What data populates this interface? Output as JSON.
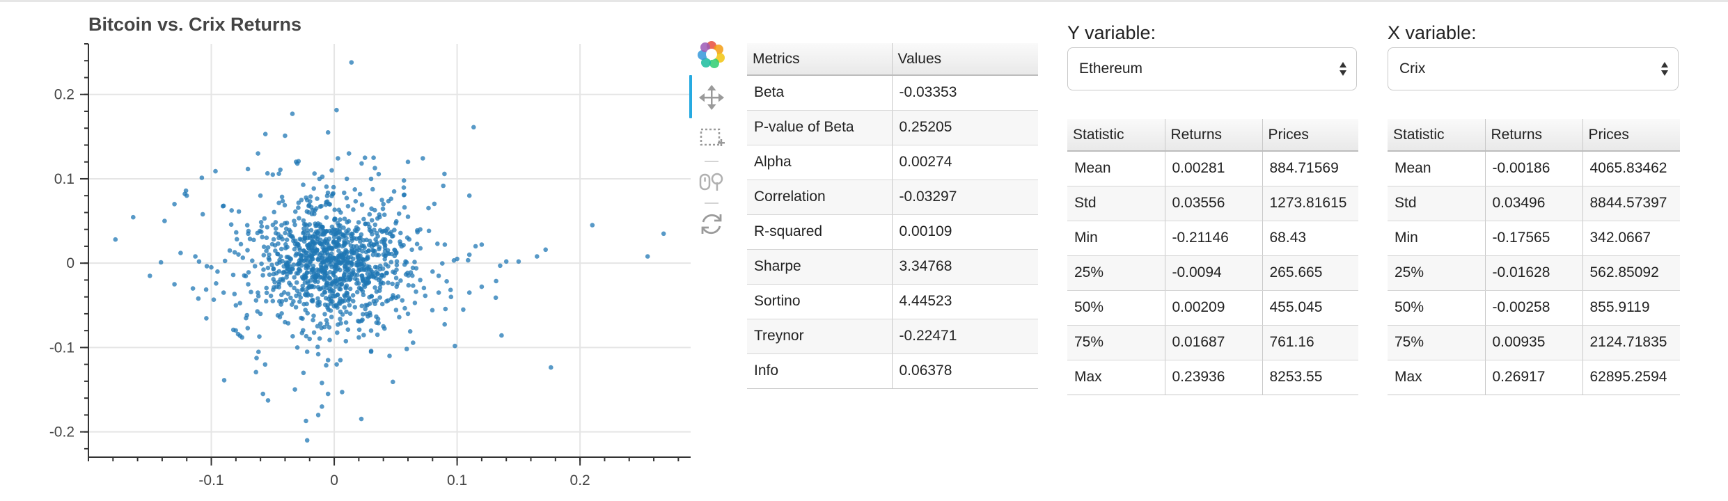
{
  "chart_data": {
    "type": "scatter",
    "title": "Bitcoin vs. Crix Returns",
    "xlabel": "",
    "ylabel": "",
    "xlim": [
      -0.2,
      0.29
    ],
    "ylim": [
      -0.23,
      0.26
    ],
    "xticks": [
      -0.1,
      0,
      0.1,
      0.2
    ],
    "xtick_labels": [
      "-0.1",
      "0",
      "0.1",
      "0.2"
    ],
    "yticks": [
      -0.2,
      -0.1,
      0,
      0.1,
      0.2
    ],
    "ytick_labels": [
      "-0.2",
      "-0.1",
      "0",
      "0.1",
      "0.2"
    ],
    "grid": true,
    "point_color": "#1f77b4",
    "approx_num_points": 1200,
    "central_spread": {
      "x_std": 0.028,
      "y_std": 0.032
    },
    "points": [
      [
        0.014,
        0.238
      ],
      [
        -0.034,
        0.177
      ],
      [
        -0.056,
        0.153
      ],
      [
        -0.04,
        0.151
      ],
      [
        -0.005,
        0.155
      ],
      [
        0.012,
        0.13
      ],
      [
        0.032,
        0.125
      ],
      [
        -0.062,
        0.13
      ],
      [
        0.025,
        0.125
      ],
      [
        -0.03,
        0.118
      ],
      [
        -0.05,
        0.105
      ],
      [
        -0.045,
        0.106
      ],
      [
        -0.002,
        0.11
      ],
      [
        0.03,
        0.1
      ],
      [
        -0.012,
        0.1
      ],
      [
        0.11,
        0.08
      ],
      [
        -0.12,
        0.08
      ],
      [
        -0.13,
        0.07
      ],
      [
        -0.09,
        0.068
      ],
      [
        0.04,
        0.07
      ],
      [
        -0.178,
        0.028
      ],
      [
        -0.138,
        0.05
      ],
      [
        -0.125,
        0.012
      ],
      [
        -0.113,
        0.008
      ],
      [
        -0.11,
        0.002
      ],
      [
        -0.1,
        -0.005
      ],
      [
        -0.09,
        -0.035
      ],
      [
        -0.115,
        -0.03
      ],
      [
        -0.13,
        -0.025
      ],
      [
        -0.15,
        -0.015
      ],
      [
        -0.141,
        0.001
      ],
      [
        -0.08,
        -0.05
      ],
      [
        -0.075,
        -0.088
      ],
      [
        0.115,
        0.02
      ],
      [
        0.12,
        0.022
      ],
      [
        0.14,
        0.002
      ],
      [
        0.135,
        -0.003
      ],
      [
        0.15,
        0.002
      ],
      [
        0.165,
        0.008
      ],
      [
        0.172,
        0.016
      ],
      [
        0.21,
        0.045
      ],
      [
        0.255,
        0.008
      ],
      [
        0.268,
        0.035
      ],
      [
        0.11,
        -0.035
      ],
      [
        0.12,
        -0.028
      ],
      [
        0.105,
        -0.055
      ],
      [
        0.095,
        -0.04
      ],
      [
        0.085,
        -0.035
      ],
      [
        0.11,
        0.01
      ],
      [
        0.1,
        0.005
      ],
      [
        0.04,
        -0.075
      ],
      [
        0.03,
        -0.08
      ],
      [
        0.02,
        -0.088
      ],
      [
        0.045,
        -0.11
      ],
      [
        0.03,
        -0.105
      ],
      [
        -0.04,
        -0.07
      ],
      [
        -0.03,
        -0.1
      ],
      [
        -0.022,
        -0.105
      ],
      [
        -0.013,
        -0.108
      ],
      [
        -0.058,
        -0.155
      ],
      [
        -0.025,
        -0.13
      ],
      [
        -0.005,
        -0.115
      ],
      [
        0.002,
        -0.12
      ],
      [
        0.005,
        -0.115
      ],
      [
        -0.01,
        -0.142
      ],
      [
        -0.005,
        -0.155
      ],
      [
        -0.01,
        -0.17
      ],
      [
        -0.013,
        -0.18
      ],
      [
        -0.023,
        -0.187
      ],
      [
        -0.022,
        -0.21
      ],
      [
        0.06,
        0.12
      ],
      [
        -0.06,
        0.08
      ],
      [
        -0.07,
        0.035
      ],
      [
        0.06,
        0.055
      ],
      [
        0.07,
        0.04
      ],
      [
        0.07,
        -0.02
      ],
      [
        0.08,
        -0.01
      ],
      [
        0.06,
        -0.06
      ],
      [
        -0.06,
        -0.06
      ],
      [
        -0.05,
        -0.045
      ],
      [
        0.09,
        0.022
      ],
      [
        0.085,
        -0.015
      ],
      [
        -0.085,
        0.015
      ],
      [
        -0.095,
        -0.01
      ],
      [
        -0.07,
        -0.025
      ]
    ]
  },
  "metrics_table": {
    "headers": [
      "Metrics",
      "Values"
    ],
    "rows": [
      [
        "Beta",
        "-0.03353"
      ],
      [
        "P-value of Beta",
        "0.25205"
      ],
      [
        "Alpha",
        "0.00274"
      ],
      [
        "Correlation",
        "-0.03297"
      ],
      [
        "R-squared",
        "0.00109"
      ],
      [
        "Sharpe",
        "3.34768"
      ],
      [
        "Sortino",
        "4.44523"
      ],
      [
        "Treynor",
        "-0.22471"
      ],
      [
        "Info",
        "0.06378"
      ]
    ]
  },
  "y_variable": {
    "label": "Y variable:",
    "selected": "Ethereum",
    "table": {
      "headers": [
        "Statistic",
        "Returns",
        "Prices"
      ],
      "rows": [
        [
          "Mean",
          "0.00281",
          "884.71569"
        ],
        [
          "Std",
          "0.03556",
          "1273.81615"
        ],
        [
          "Min",
          "-0.21146",
          "68.43"
        ],
        [
          "25%",
          "-0.0094",
          "265.665"
        ],
        [
          "50%",
          "0.00209",
          "455.045"
        ],
        [
          "75%",
          "0.01687",
          "761.16"
        ],
        [
          "Max",
          "0.23936",
          "8253.55"
        ]
      ]
    }
  },
  "x_variable": {
    "label": "X variable:",
    "selected": "Crix",
    "table": {
      "headers": [
        "Statistic",
        "Returns",
        "Prices"
      ],
      "rows": [
        [
          "Mean",
          "-0.00186",
          "4065.83462"
        ],
        [
          "Std",
          "0.03496",
          "8844.57397"
        ],
        [
          "Min",
          "-0.17565",
          "342.0667"
        ],
        [
          "25%",
          "-0.01628",
          "562.85092"
        ],
        [
          "50%",
          "-0.00258",
          "855.9119"
        ],
        [
          "75%",
          "0.00935",
          "2124.71835"
        ],
        [
          "Max",
          "0.26917",
          "62895.2594"
        ]
      ]
    }
  },
  "toolbar": {
    "tools": [
      "bokeh-logo-icon",
      "pan-icon",
      "box-zoom-icon",
      "wheel-zoom-icon",
      "reset-icon"
    ],
    "active": "pan-icon"
  }
}
